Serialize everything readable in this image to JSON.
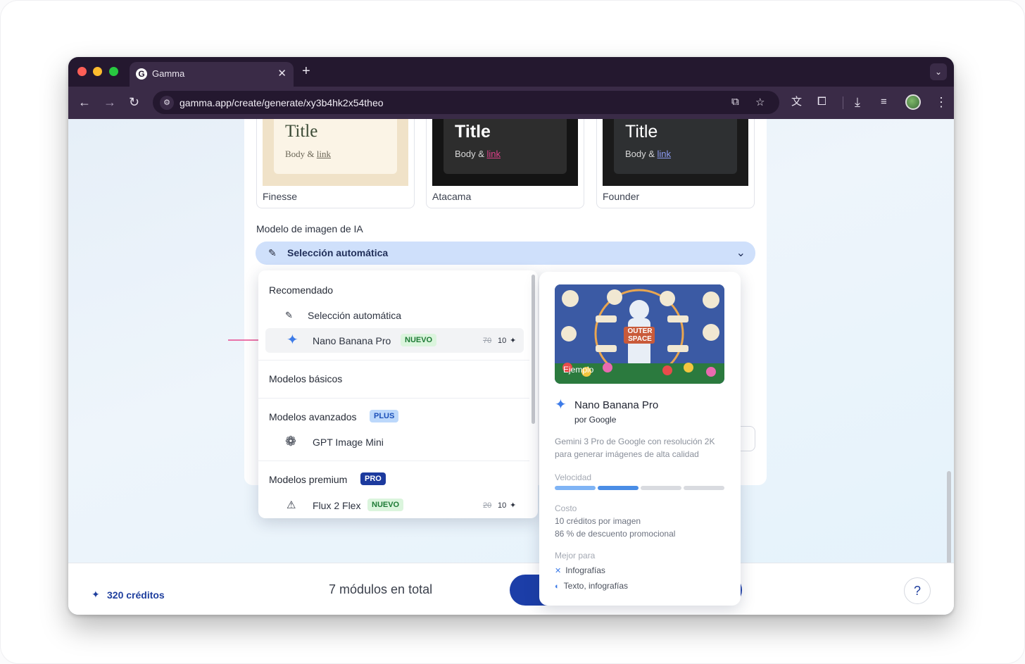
{
  "browser": {
    "tab_title": "Gamma",
    "tab_favicon": "G",
    "url": "gamma.app/create/generate/xy3b4hk2x54theo",
    "icons": [
      "back-icon",
      "forward-icon",
      "reload-icon",
      "site-info-icon",
      "install-app-icon",
      "bookmark-star-icon",
      "translate-icon",
      "extensions-icon",
      "download-icon",
      "reading-list-icon",
      "profile-avatar",
      "more-menu-icon"
    ]
  },
  "themes": [
    {
      "name": "Finesse",
      "title": "Title",
      "body": "Body & ",
      "link": "link"
    },
    {
      "name": "Atacama",
      "title": "Title",
      "body": "Body & ",
      "link": "link"
    },
    {
      "name": "Founder",
      "title": "Title",
      "body": "Body & ",
      "link": "link"
    }
  ],
  "image_model": {
    "label": "Modelo de imagen de IA",
    "selected": "Selección automática"
  },
  "dropdown": {
    "recommended_header": "Recomendado",
    "auto_item": "Selección automática",
    "nano_item": "Nano Banana Pro",
    "nano_badge": "NUEVO",
    "nano_cost_old": "70",
    "nano_cost_new": "10",
    "basic_header": "Modelos básicos",
    "advanced_header": "Modelos avanzados",
    "advanced_badge": "PLUS",
    "gpt_item": "GPT Image Mini",
    "premium_header": "Modelos premium",
    "premium_badge": "PRO",
    "flux_item": "Flux 2 Flex",
    "flux_badge": "NUEVO",
    "flux_cost_old": "20",
    "flux_cost_new": "10"
  },
  "preview": {
    "image_caption": "Ejemplo",
    "image_text": "OUTER SPACE",
    "title": "Nano Banana Pro",
    "by": "por Google",
    "description": "Gemini 3 Pro de Google con resolución 2K para generar imágenes de alta calidad",
    "speed_label": "Velocidad",
    "speed_level": 0.5,
    "cost_label": "Costo",
    "cost_line1": "10 créditos por imagen",
    "cost_line2": "86 % de descuento promocional",
    "best_label": "Mejor para",
    "best_items": [
      "Infografías",
      "Texto, infografías"
    ]
  },
  "footer": {
    "credits": "320 créditos",
    "total": "7 módulos en total",
    "help": "?"
  },
  "colors": {
    "accent": "#1c3ea8",
    "select_bg": "#cfe0fb",
    "badge_new": "#dbf5dd",
    "annotation_arrow": "#e8488e"
  }
}
